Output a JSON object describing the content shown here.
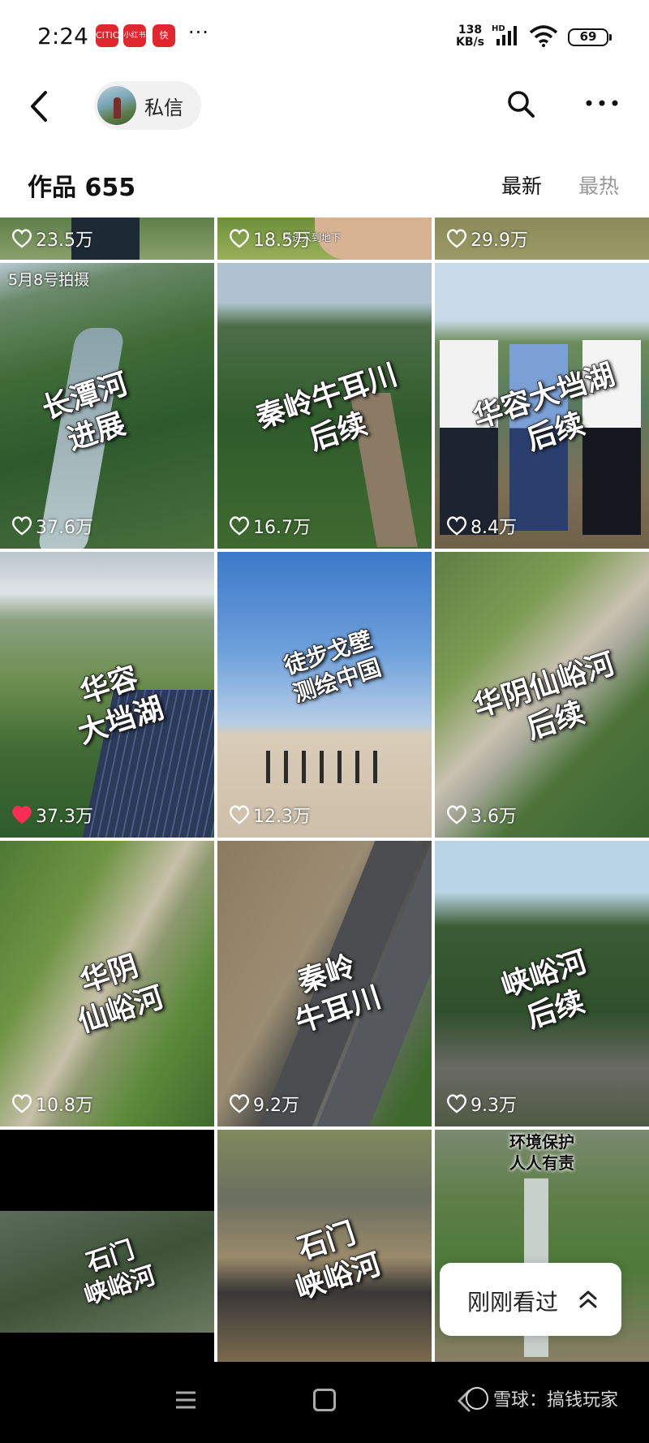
{
  "status_bar": {
    "time": "2:24",
    "app_icons": [
      "CITIC",
      "小红书",
      "快"
    ],
    "more": "···",
    "net_speed_value": "138",
    "net_speed_unit": "KB/s",
    "hd": "HD",
    "battery": "69"
  },
  "header": {
    "message_label": "私信"
  },
  "profile": {
    "works_label": "作品 655",
    "sort_tabs": [
      "最新",
      "最热"
    ],
    "active_tab": "最新"
  },
  "videos": [
    {
      "likes": "23.5万",
      "liked": false
    },
    {
      "likes": "18.5万",
      "liked": false,
      "note": "坑进入到地下"
    },
    {
      "likes": "29.9万",
      "liked": false
    },
    {
      "likes": "37.6万",
      "liked": false,
      "title": "长潭河\n进展",
      "tag": "5月8号拍摄"
    },
    {
      "likes": "16.7万",
      "liked": false,
      "title": "秦岭牛耳川\n后续"
    },
    {
      "likes": "8.4万",
      "liked": false,
      "title": "华容大垱湖\n后续"
    },
    {
      "likes": "37.3万",
      "liked": true,
      "title": "华容\n大垱湖"
    },
    {
      "likes": "12.3万",
      "liked": false,
      "title": "徒步戈壁\n测绘中国"
    },
    {
      "likes": "3.6万",
      "liked": false,
      "title": "华阴仙峪河\n后续"
    },
    {
      "likes": "10.8万",
      "liked": false,
      "title": "华阴\n仙峪河"
    },
    {
      "likes": "9.2万",
      "liked": false,
      "title": "秦岭\n牛耳川"
    },
    {
      "likes": "9.3万",
      "liked": false,
      "title": "峡峪河\n后续"
    },
    {
      "title": "石门\n峡峪河"
    },
    {
      "title": "石门\n峡峪河"
    },
    {
      "title": "环境保护\n人人有责"
    }
  ],
  "recent_button": {
    "label": "刚刚看过"
  },
  "watermark": "雪球：搞钱玩家",
  "colors": {
    "like_active": "#ff2c55",
    "inactive_tab": "#999999"
  }
}
